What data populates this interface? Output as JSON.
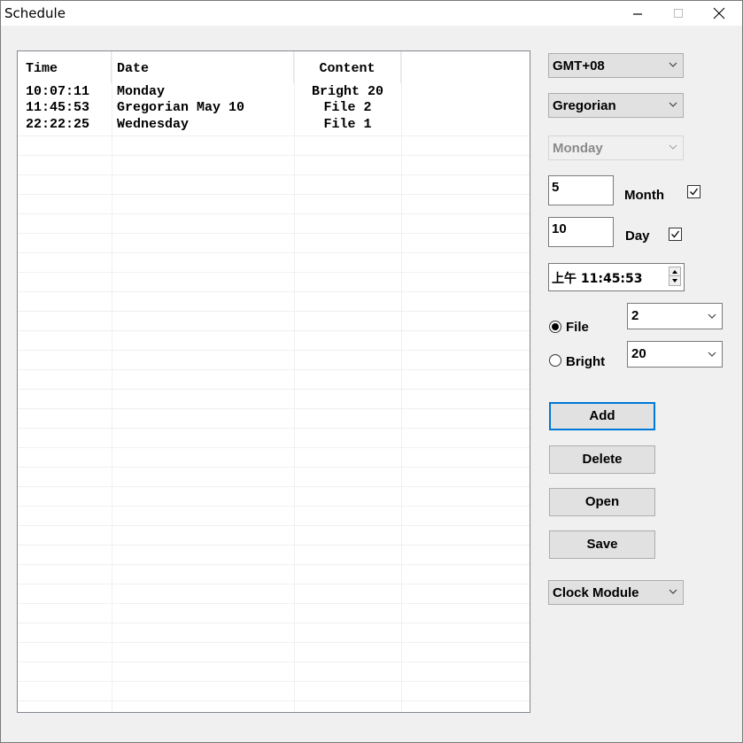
{
  "window": {
    "title": "Schedule",
    "minimize_glyph": "–",
    "maximize_glyph": "☐",
    "close_glyph": "✕"
  },
  "schedule_list": {
    "columns": [
      "Time",
      "Date",
      "Content",
      ""
    ],
    "rows": [
      {
        "time": "10:07:11",
        "date": "Monday",
        "content": "Bright 20"
      },
      {
        "time": "11:45:53",
        "date": "Gregorian May 10",
        "content": "File 2"
      },
      {
        "time": "22:22:25",
        "date": "Wednesday",
        "content": "File 1"
      }
    ]
  },
  "controls": {
    "timezone": "GMT+08",
    "calendar": "Gregorian",
    "weekday": "Monday",
    "month_value": "5",
    "month_label": "Month",
    "month_checked": true,
    "day_value": "10",
    "day_label": "Day",
    "day_checked": true,
    "time_value": "上午 11:45:53",
    "file_label": "File",
    "file_selected": true,
    "file_value": "2",
    "bright_label": "Bright",
    "bright_selected": false,
    "bright_value": "20",
    "device": "Clock Module"
  },
  "buttons": {
    "add": "Add",
    "delete": "Delete",
    "open": "Open",
    "save": "Save"
  }
}
